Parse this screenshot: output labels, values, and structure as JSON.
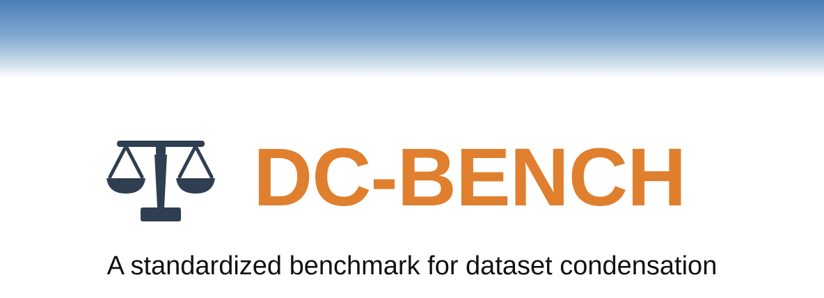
{
  "header": {
    "gradient_colors": [
      "#4a7db5",
      "#ffffff"
    ]
  },
  "logo": {
    "icon": "balance-scale-icon",
    "icon_color": "#2f3e51",
    "title": "DC-BENCH",
    "title_color": "#e07f2e"
  },
  "tagline": "A standardized benchmark for dataset condensation"
}
